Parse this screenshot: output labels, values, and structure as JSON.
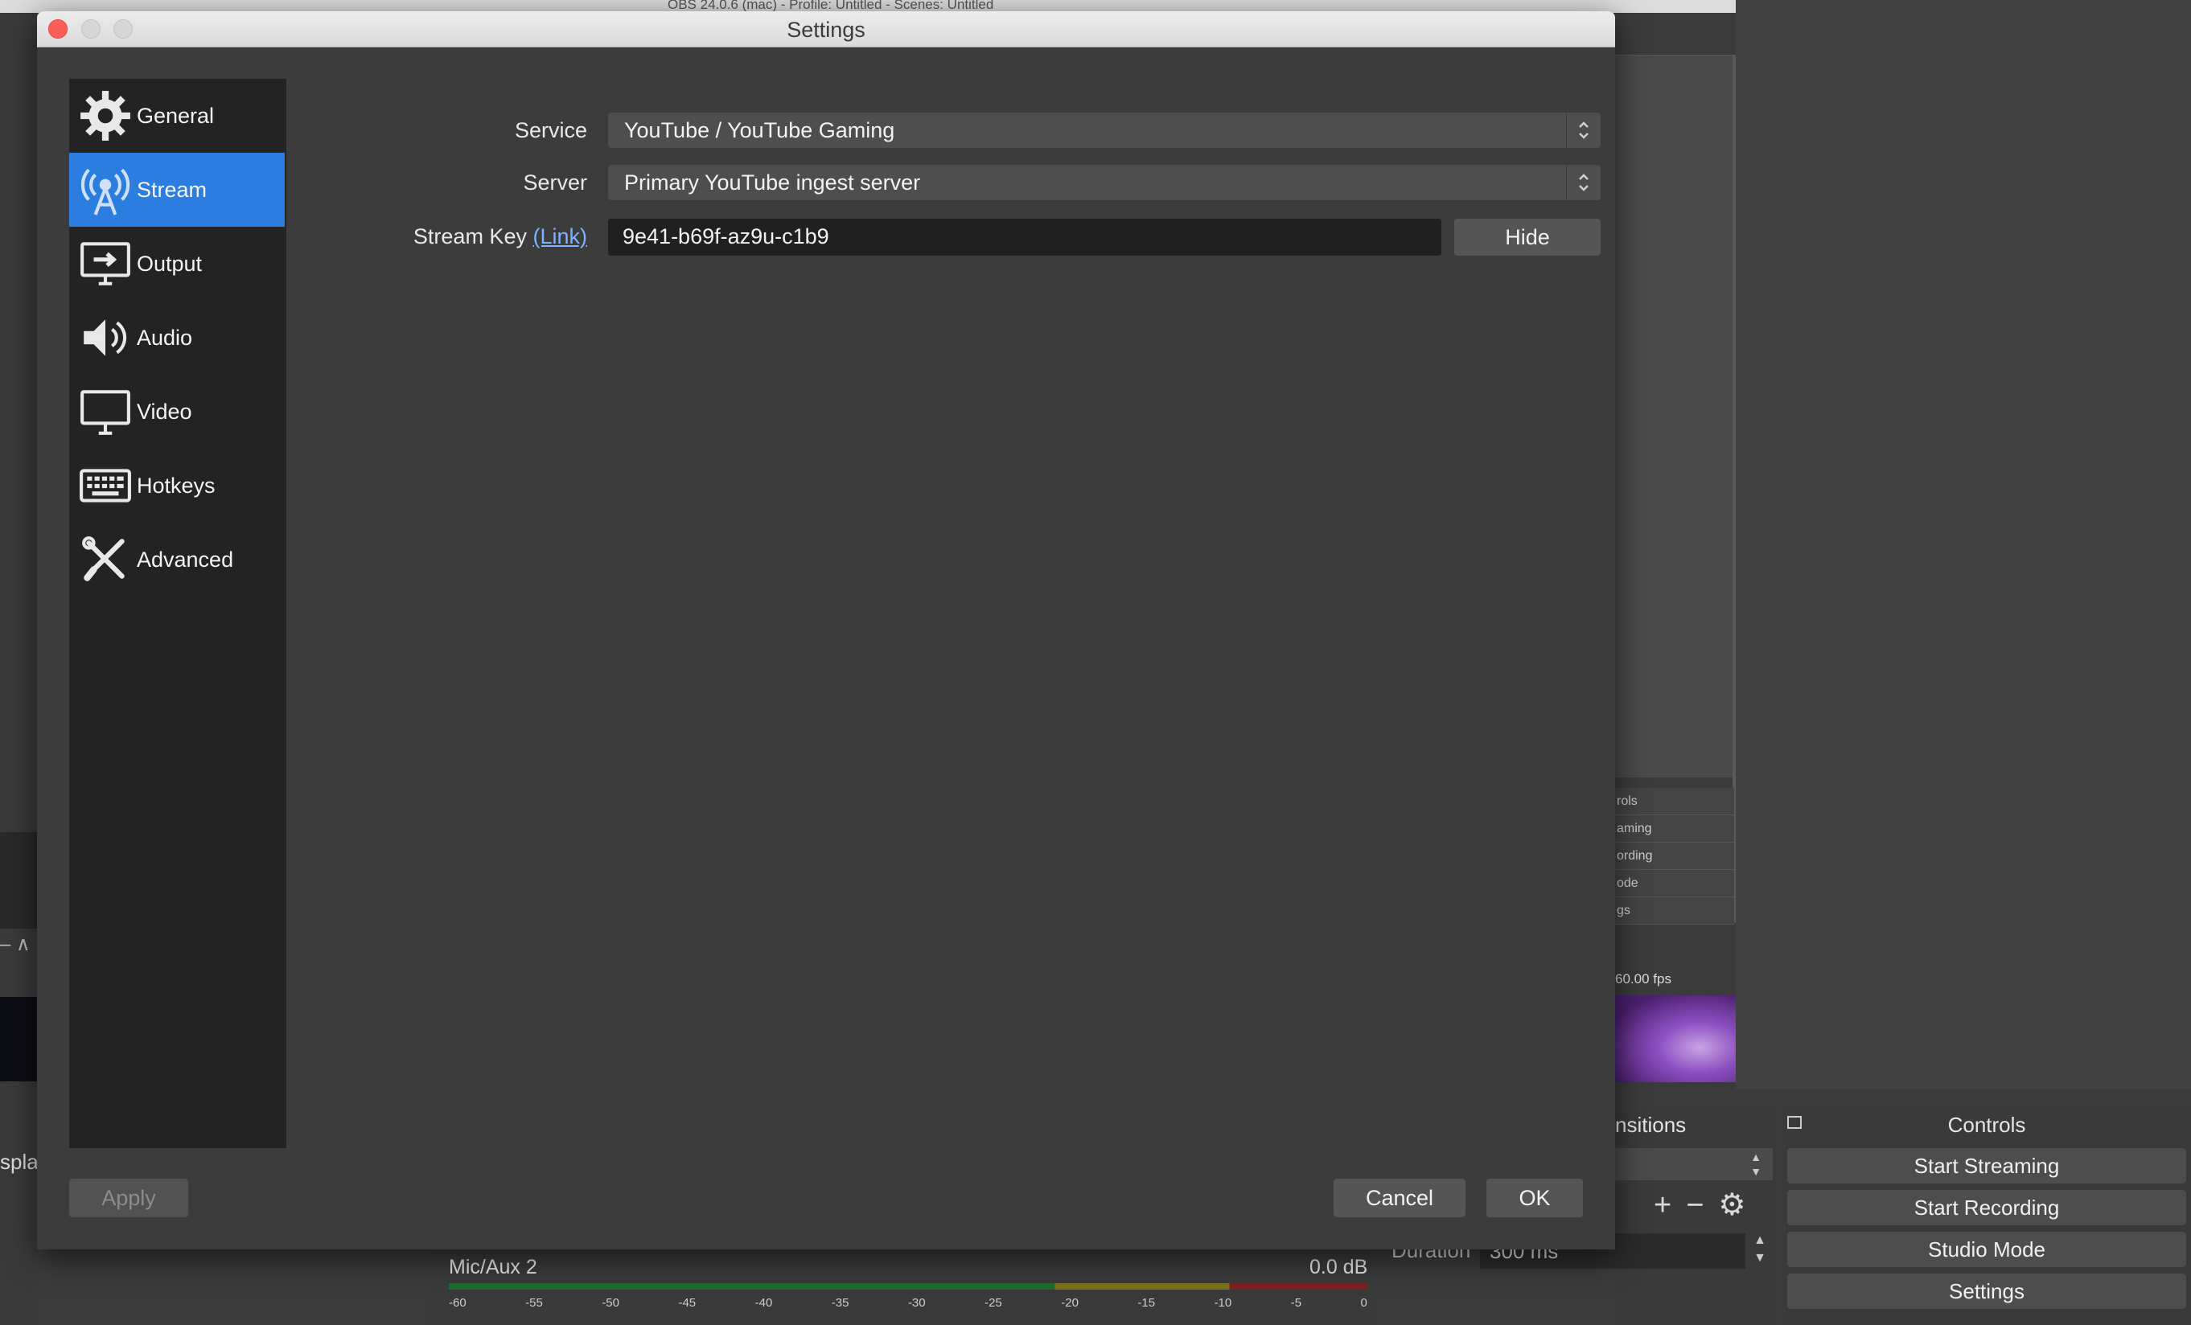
{
  "background": {
    "window_title": "OBS 24.0.6 (mac) - Profile: Untitled - Scenes: Untitled",
    "left_partial_text": "spla",
    "left_partial_dash": "– ∧",
    "dock_rows": [
      "rols",
      "aming",
      "ording",
      "ode",
      "gs"
    ],
    "fps_text": "60.00 fps",
    "transitions_title": "nsitions",
    "duration_label": "Duration",
    "duration_value": "300 ms",
    "controls_title": "Controls",
    "control_buttons": [
      "Start Streaming",
      "Start Recording",
      "Studio Mode",
      "Settings"
    ],
    "mixer": {
      "source_name": "Mic/Aux 2",
      "db_value": "0.0 dB",
      "ticks": [
        "-60",
        "-55",
        "-50",
        "-45",
        "-40",
        "-35",
        "-30",
        "-25",
        "-20",
        "-15",
        "-10",
        "-5",
        "0"
      ]
    }
  },
  "dialog": {
    "title": "Settings",
    "sidebar": [
      {
        "label": "General",
        "icon": "gear-icon"
      },
      {
        "label": "Stream",
        "icon": "antenna-icon",
        "active": true
      },
      {
        "label": "Output",
        "icon": "output-monitor-icon"
      },
      {
        "label": "Audio",
        "icon": "speaker-icon"
      },
      {
        "label": "Video",
        "icon": "monitor-icon"
      },
      {
        "label": "Hotkeys",
        "icon": "keyboard-icon"
      },
      {
        "label": "Advanced",
        "icon": "tools-icon"
      }
    ],
    "stream": {
      "service_label": "Service",
      "service_value": "YouTube / YouTube Gaming",
      "server_label": "Server",
      "server_value": "Primary YouTube ingest server",
      "stream_key_label": "Stream Key",
      "stream_key_link": "(Link)",
      "stream_key_value": "9e41-b69f-az9u-c1b9",
      "hide_button": "Hide"
    },
    "buttons": {
      "apply": "Apply",
      "cancel": "Cancel",
      "ok": "OK"
    }
  },
  "colors": {
    "accent": "#2b7ee0",
    "dialog_bg": "#3c3c3c",
    "sidebar_bg": "#232323",
    "link": "#7db3ff"
  }
}
